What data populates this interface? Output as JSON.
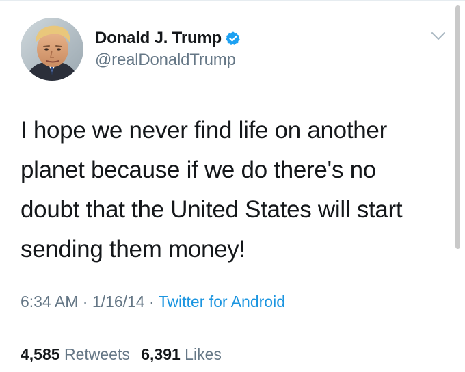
{
  "header": {
    "display_name": "Donald J. Trump",
    "handle": "@realDonaldTrump"
  },
  "tweet": {
    "lines": [
      "I hope we never find life on another",
      "planet because if we do there's no",
      "doubt that the United States will start",
      "sending them money!"
    ]
  },
  "meta": {
    "time": "6:34 AM",
    "separator": " · ",
    "date": "1/16/14",
    "source": "Twitter for Android"
  },
  "stats": {
    "retweets_count": "4,585",
    "retweets_label": "Retweets",
    "likes_count": "6,391",
    "likes_label": "Likes"
  },
  "icons": {
    "verified": "verified-badge-icon",
    "caret": "chevron-down-icon"
  },
  "colors": {
    "text": "#14171a",
    "secondary": "#657786",
    "link": "#1b95e0",
    "verified": "#1da1f2"
  }
}
